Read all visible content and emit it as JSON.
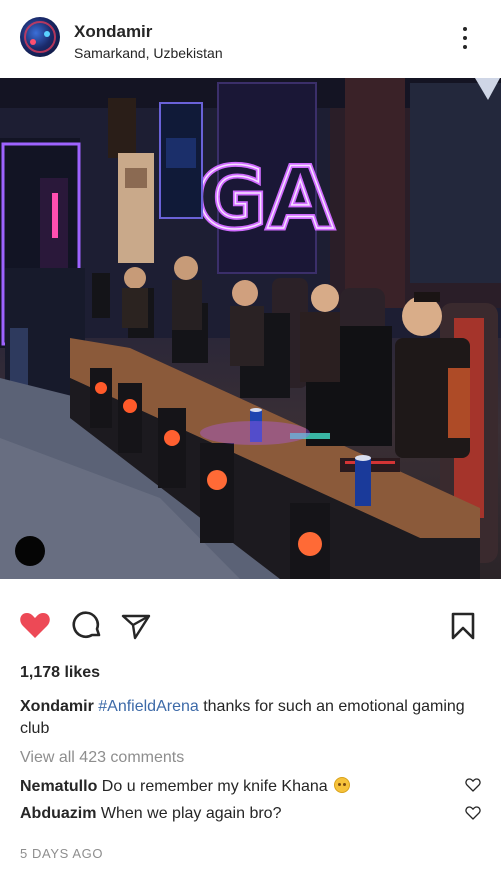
{
  "post": {
    "username": "Xondamir",
    "location": "Samarkand, Uzbekistan",
    "likes_text": "1,178 likes",
    "caption": {
      "author": "Xondamir",
      "hashtag": "#AnfieldArena",
      "text": " thanks for such an emotional gaming club"
    },
    "view_all_comments": "View all 423 comments",
    "comments": [
      {
        "author": "Nematullo",
        "text": "Do u remember my knife Khana",
        "emoji": "smiling-face-emoji"
      },
      {
        "author": "Abduazim",
        "text": "When we play again bro?"
      }
    ],
    "timestamp": "5 DAYS AGO",
    "liked": true
  },
  "photo": {
    "description_icon": "gaming-club-photo",
    "sign_text": "GA"
  },
  "colors": {
    "like_red": "#ed4956",
    "hashtag_blue": "#3d6aa8",
    "muted_gray": "#8e8e8e",
    "neon_purple": "#b45cff"
  }
}
